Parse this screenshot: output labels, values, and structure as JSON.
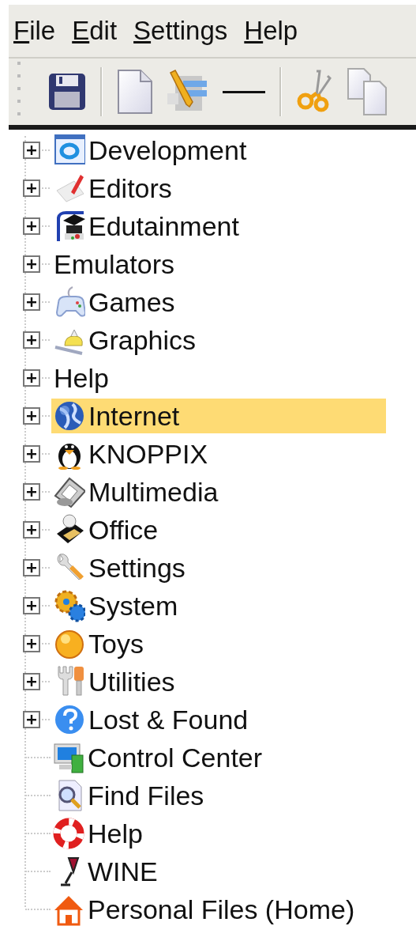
{
  "menu_bar": {
    "items": [
      {
        "label": "File"
      },
      {
        "label": "Edit"
      },
      {
        "label": "Settings"
      },
      {
        "label": "Help"
      }
    ]
  },
  "tree": {
    "items": [
      {
        "kind": "folder",
        "label": "Development",
        "expanded": false,
        "selected": false
      },
      {
        "kind": "folder",
        "label": "Editors",
        "expanded": false,
        "selected": false
      },
      {
        "kind": "folder",
        "label": "Edutainment",
        "expanded": false,
        "selected": false
      },
      {
        "kind": "folder",
        "label": "Emulators",
        "expanded": false,
        "selected": false
      },
      {
        "kind": "folder",
        "label": "Games",
        "expanded": false,
        "selected": false
      },
      {
        "kind": "folder",
        "label": "Graphics",
        "expanded": false,
        "selected": false
      },
      {
        "kind": "folder",
        "label": "Help",
        "expanded": false,
        "selected": false
      },
      {
        "kind": "folder",
        "label": "Internet",
        "expanded": false,
        "selected": true
      },
      {
        "kind": "folder",
        "label": "KNOPPIX",
        "expanded": false,
        "selected": false
      },
      {
        "kind": "folder",
        "label": "Multimedia",
        "expanded": false,
        "selected": false
      },
      {
        "kind": "folder",
        "label": "Office",
        "expanded": false,
        "selected": false
      },
      {
        "kind": "folder",
        "label": "Settings",
        "expanded": false,
        "selected": false
      },
      {
        "kind": "folder",
        "label": "System",
        "expanded": false,
        "selected": false
      },
      {
        "kind": "folder",
        "label": "Toys",
        "expanded": false,
        "selected": false
      },
      {
        "kind": "folder",
        "label": "Utilities",
        "expanded": false,
        "selected": false
      },
      {
        "kind": "folder",
        "label": "Lost & Found",
        "expanded": false,
        "selected": false
      },
      {
        "kind": "entry",
        "label": "Control Center",
        "selected": false
      },
      {
        "kind": "entry",
        "label": "Find Files",
        "selected": false
      },
      {
        "kind": "entry",
        "label": "Help",
        "selected": false
      },
      {
        "kind": "entry",
        "label": "WINE",
        "selected": false
      },
      {
        "kind": "entry",
        "label": "Personal Files (Home)",
        "selected": false
      }
    ]
  }
}
